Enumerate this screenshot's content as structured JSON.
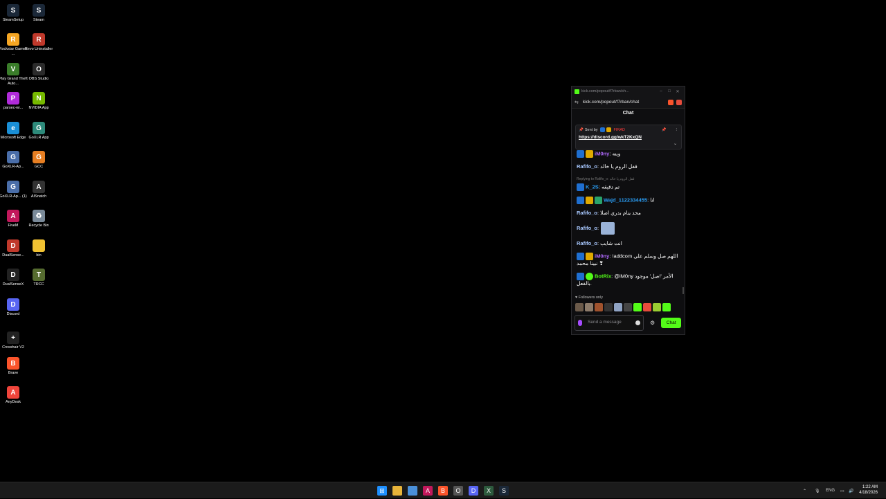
{
  "desktop": {
    "icons": [
      {
        "label": "SteamSetup",
        "color": "#1b2838",
        "glyph": "S"
      },
      {
        "label": "Steam",
        "color": "#1b2838",
        "glyph": "S"
      },
      {
        "label": "Rockstar Games ...",
        "color": "#f5a623",
        "glyph": "R"
      },
      {
        "label": "Revo Uninstaller",
        "color": "#c0392b",
        "glyph": "R"
      },
      {
        "label": "Play Grand Theft Auto...",
        "color": "#3a7d2a",
        "glyph": "V"
      },
      {
        "label": "OBS Studio",
        "color": "#2b2b2b",
        "glyph": "O"
      },
      {
        "label": "parsec-wi...",
        "color": "#b02bd9",
        "glyph": "P"
      },
      {
        "label": "NVIDIA App",
        "color": "#76b900",
        "glyph": "N"
      },
      {
        "label": "Microsoft Edge",
        "color": "#1a8fd6",
        "glyph": "e"
      },
      {
        "label": "GoXLR App",
        "color": "#2d8a7a",
        "glyph": "G"
      },
      {
        "label": "GoXLR-Ap...",
        "color": "#4a6ea9",
        "glyph": "G"
      },
      {
        "label": "GCC",
        "color": "#e67e22",
        "glyph": "G"
      },
      {
        "label": "GoXLR-Ap... (1)",
        "color": "#4a6ea9",
        "glyph": "G"
      },
      {
        "label": "AISnatch",
        "color": "#333333",
        "glyph": "A"
      },
      {
        "label": "FiveM",
        "color": "#c2185b",
        "glyph": "A"
      },
      {
        "label": "Recycle Bin",
        "color": "#7a8a99",
        "glyph": "♻"
      },
      {
        "label": "DualSense...",
        "color": "#c0392b",
        "glyph": "D"
      },
      {
        "label": "bin",
        "color": "#f1c232",
        "glyph": ""
      },
      {
        "label": "DualSenseX",
        "color": "#222222",
        "glyph": "D"
      },
      {
        "label": "TRCC",
        "color": "#556b2f",
        "glyph": "T"
      },
      {
        "label": "Discord",
        "color": "#5865f2",
        "glyph": "D"
      },
      {
        "label": "Crosshair V2",
        "color": "#222222",
        "glyph": "+"
      },
      {
        "label": "Brave",
        "color": "#fb542b",
        "glyph": "B"
      },
      {
        "label": "AnyDesk",
        "color": "#ef443b",
        "glyph": "A"
      }
    ]
  },
  "window": {
    "title": "kick.com/popout/f7rban/ch...",
    "url": "kick.com/popout/f7rban/chat",
    "header": "Chat"
  },
  "pinned": {
    "sent_by": "Sent by",
    "sender": "FIRAD",
    "link": "https://discord.gg/wkT2KxQN"
  },
  "messages": [
    {
      "user": "iM0ny",
      "color": "#b26bff",
      "text": ": وينه",
      "badges": [
        "vip",
        "sub"
      ]
    },
    {
      "user": "Rafifo_o",
      "color": "#a8c8ff",
      "text": ": قفل الروم يا خالد",
      "badges": []
    },
    {
      "user": "K_2S",
      "color": "#2a9df4",
      "text": ": تم دقيقه",
      "badges": [
        "vip"
      ],
      "reply": "Replying to Rafifo_o: قفل الروم يا خالد"
    },
    {
      "user": "Wajd_1122334455",
      "color": "#2a9df4",
      "text": ": انا",
      "badges": [
        "vip",
        "sub",
        "gift"
      ]
    },
    {
      "user": "Rafifo_o",
      "color": "#a8c8ff",
      "text": ": محد ينام بدري اصلا",
      "badges": []
    },
    {
      "user": "Rafifo_o",
      "color": "#a8c8ff",
      "text": ":",
      "badges": [],
      "image": true
    },
    {
      "user": "Rafifo_o",
      "color": "#a8c8ff",
      "text": ": انت شايب",
      "badges": []
    },
    {
      "user": "iM0ny",
      "color": "#b26bff",
      "text": ": !addcom اللهم صل وسلم على نبينا محمد ❣",
      "badges": [
        "vip",
        "sub"
      ]
    },
    {
      "user": "BotRix",
      "color": "#53fc18",
      "text": ": @iM0ny الأمر '!صل' موجود بالفعل.",
      "badges": [
        "vip",
        "verified"
      ]
    }
  ],
  "footer": {
    "followers_only": "Followers only",
    "placeholder": "Send a message",
    "chat_button": "Chat"
  },
  "taskbar": {
    "language": "ENG",
    "time": "1:22 AM",
    "date": "4/18/2026"
  }
}
